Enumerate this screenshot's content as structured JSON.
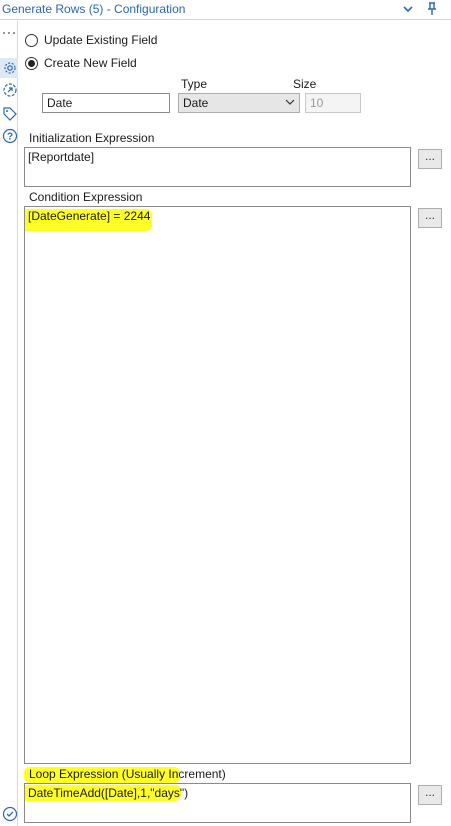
{
  "window": {
    "title": "Generate Rows (5) - Configuration"
  },
  "sidebar": {
    "more_dots": "···",
    "icons": [
      "gear-icon",
      "refresh-arrow-icon",
      "tag-icon",
      "help-icon"
    ],
    "bottom_icon": "check-circle-icon"
  },
  "field_mode": {
    "update_existing_label": "Update Existing Field",
    "create_new_label": "Create New  Field",
    "selected": "create_new"
  },
  "new_field": {
    "type_header": "Type",
    "size_header": "Size",
    "name_value": "Date",
    "type_value": "Date",
    "size_value": "10"
  },
  "initialization": {
    "label": "Initialization Expression",
    "value": "[Reportdate]",
    "button_label": "..."
  },
  "condition": {
    "label": "Condition Expression",
    "value": "[DateGenerate] = 2244",
    "button_label": "..."
  },
  "loop": {
    "label": "Loop Expression (Usually Increment)",
    "value": "DateTimeAdd([Date],1,\"days\")",
    "button_label": "..."
  },
  "colors": {
    "accent": "#2b67b5",
    "highlight": "#ffff00"
  }
}
